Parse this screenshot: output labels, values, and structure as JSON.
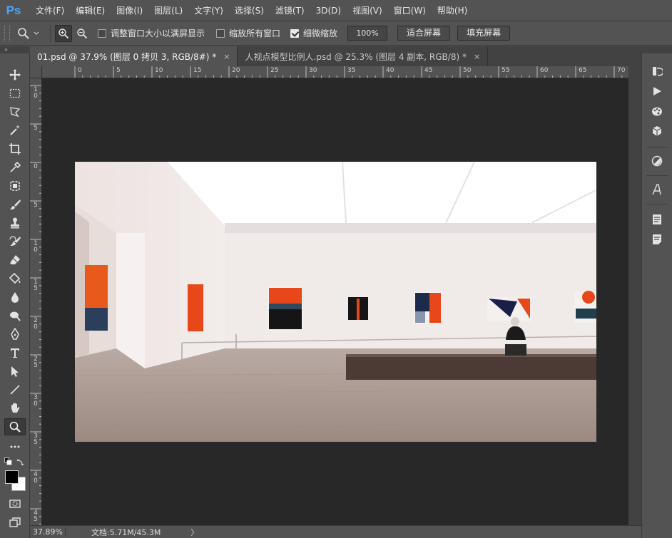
{
  "app": {
    "logo": "Ps"
  },
  "menu": [
    "文件(F)",
    "编辑(E)",
    "图像(I)",
    "图层(L)",
    "文字(Y)",
    "选择(S)",
    "滤镜(T)",
    "3D(D)",
    "视图(V)",
    "窗口(W)",
    "帮助(H)"
  ],
  "options": {
    "resize_windows": "调整窗口大小以满屏显示",
    "zoom_all_windows": "缩放所有窗口",
    "scrubby_zoom": "细微缩放",
    "zoom_value": "100%",
    "fit_screen": "适合屏幕",
    "fill_screen": "填充屏幕",
    "checked": {
      "resize_windows": false,
      "zoom_all_windows": false,
      "scrubby_zoom": true
    }
  },
  "tabs": [
    {
      "title": "01.psd @ 37.9% (图层 0 拷贝 3, RGB/8#) *",
      "close": "×",
      "active": true
    },
    {
      "title": "人视点模型比例人.psd @ 25.3% (图层 4 副本, RGB/8) *",
      "close": "×",
      "active": false
    }
  ],
  "ruler_top": [
    "0",
    "5",
    "10",
    "15",
    "20",
    "25",
    "30",
    "35",
    "40",
    "45",
    "50",
    "55",
    "60",
    "65",
    "70"
  ],
  "ruler_left": [
    "1\n0",
    "5",
    "0",
    "5",
    "1\n0",
    "1\n5",
    "2\n0",
    "2\n5",
    "3\n0",
    "3\n5",
    "4\n0",
    "4\n5"
  ],
  "status": {
    "zoom": "37.89%",
    "doc": "文档:5.71M/45.3M",
    "arrow": "〉"
  },
  "colors": {
    "chrome": "#535353",
    "dark": "#424242",
    "canvas": "#282828",
    "accent": "#4ea6ff"
  }
}
